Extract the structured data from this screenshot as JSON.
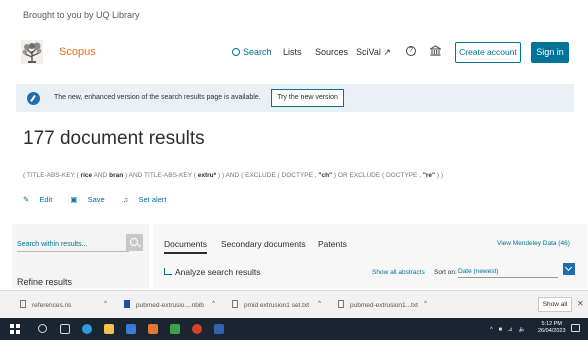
{
  "library_banner": "Brought to you by UQ Library",
  "header": {
    "logo_text": "Scopus",
    "nav_search": "Search",
    "nav_lists": "Lists",
    "nav_sources": "Sources",
    "nav_scival": "SciVal ↗",
    "help_glyph": "?",
    "create_account": "Create account",
    "sign_in": "Sign in"
  },
  "notice": {
    "text": "The new, enhanced version of the search results page is available.",
    "button": "Try the new version"
  },
  "results": {
    "title": "177 document results",
    "query_parts": [
      "( TITLE-ABS-KEY ( ",
      "rice",
      " AND ",
      "bran",
      " ) AND TITLE-ABS-KEY ( ",
      "extru*",
      " ) ) AND ( EXCLUDE ( DOCTYPE , ",
      "\"ch\"",
      " ) OR EXCLUDE ( DOCTYPE , ",
      "\"re\"",
      " ) )"
    ],
    "actions": {
      "edit": "Edit",
      "save": "Save",
      "set_alert": "Set alert"
    }
  },
  "left_panel": {
    "search_within_placeholder": "Search within results...",
    "refine": "Refine results"
  },
  "main_panel": {
    "tabs": [
      "Documents",
      "Secondary documents",
      "Patents"
    ],
    "mendeley": "View Mendeley Data (46)",
    "analyze": "Analyze search results",
    "show_abstracts": "Show all abstracts",
    "sort_label": "Sort on:",
    "sort_value": "Date (newest)"
  },
  "downloads": {
    "items": [
      "references.ris",
      "pubmed-extrusio....nbib",
      "pmid extrusion1 set.txt",
      "pubmed-extrusion1...txt"
    ],
    "show_all": "Show all",
    "close": "✕"
  },
  "taskbar": {
    "time": "5:12 PM",
    "date": "26/04/2023",
    "tray": "^ ■ ⊿ 🔈"
  },
  "colors": {
    "accent": "#007398",
    "brand": "#e9711c",
    "notice_bg": "#e9f1f7",
    "taskbar": "#1b2431"
  }
}
